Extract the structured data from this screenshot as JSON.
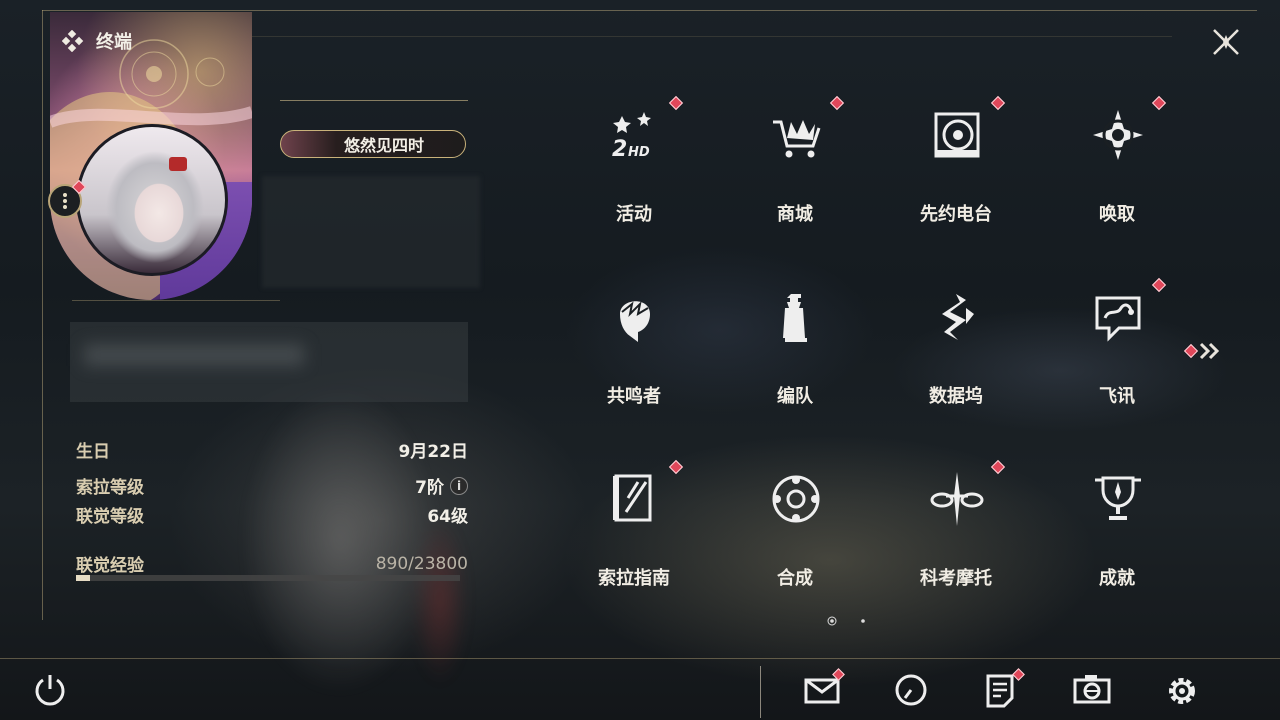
{
  "header": {
    "title": "终端",
    "title_icon": "diamond-grid-icon",
    "close_icon": "close-x-icon"
  },
  "profile": {
    "name": "悠然见四时",
    "info": [
      {
        "key": "生日",
        "value": "9月22日"
      },
      {
        "key": "索拉等级",
        "value": "7阶",
        "has_info_icon": true
      },
      {
        "key": "联觉等级",
        "value": "64级"
      }
    ],
    "exp_label": "联觉经验",
    "exp_value": "890/23800",
    "exp_fraction": 0.037
  },
  "menu": {
    "items": [
      {
        "label": "活动",
        "icon": "event-2hd-icon",
        "badge": true
      },
      {
        "label": "商城",
        "icon": "shop-cart-icon",
        "badge": true
      },
      {
        "label": "先约电台",
        "icon": "radio-disc-icon",
        "badge": true
      },
      {
        "label": "唤取",
        "icon": "compass-star-icon",
        "badge": true
      },
      {
        "label": "共鸣者",
        "icon": "resonator-head-icon",
        "badge": false
      },
      {
        "label": "编队",
        "icon": "chess-pieces-icon",
        "badge": false
      },
      {
        "label": "数据坞",
        "icon": "data-dock-icon",
        "badge": false
      },
      {
        "label": "飞讯",
        "icon": "chat-bubble-icon",
        "badge": true
      },
      {
        "label": "索拉指南",
        "icon": "guide-book-icon",
        "badge": true
      },
      {
        "label": "合成",
        "icon": "synthesis-ring-icon",
        "badge": false
      },
      {
        "label": "科考摩托",
        "icon": "motorcycle-icon",
        "badge": true
      },
      {
        "label": "成就",
        "icon": "trophy-icon",
        "badge": false
      }
    ],
    "page_count": 2,
    "current_page": 1
  },
  "bottom_bar": {
    "power_icon": "power-icon",
    "buttons": [
      {
        "name": "mail",
        "icon": "mail-icon",
        "badge": true
      },
      {
        "name": "clock",
        "icon": "clock-icon",
        "badge": false
      },
      {
        "name": "notice",
        "icon": "notice-icon",
        "badge": true
      },
      {
        "name": "camera",
        "icon": "camera-icon",
        "badge": false
      },
      {
        "name": "settings",
        "icon": "gear-icon",
        "badge": false
      }
    ]
  },
  "colors": {
    "accent_gold": "#c9b27a",
    "badge_red": "#e0475a",
    "text": "#ece8de"
  }
}
